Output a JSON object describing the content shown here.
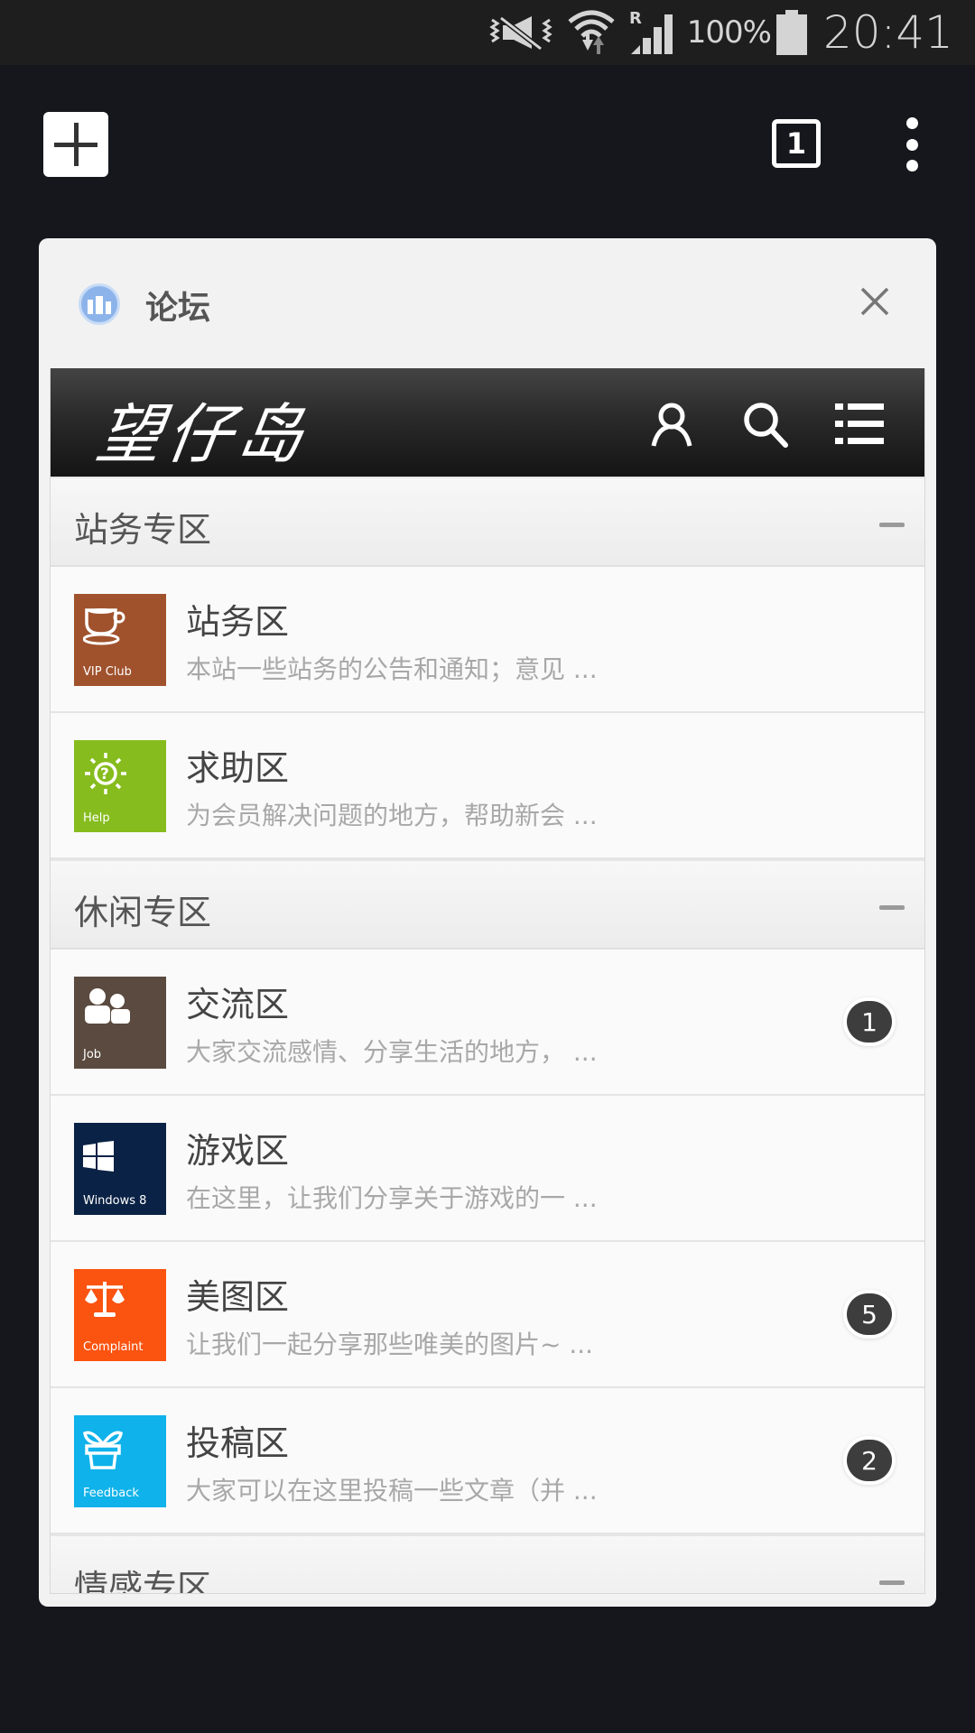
{
  "status_bar": {
    "icons": [
      "vibrate-mute-icon",
      "wifi-icon",
      "roaming-signal-icon",
      "battery-icon"
    ],
    "roaming_label": "R",
    "battery_percent": "100%",
    "time": "20:41"
  },
  "toolbar": {
    "new_tab_icon": "plus-icon",
    "tab_count": "1",
    "overflow_icon": "more-vertical-icon"
  },
  "tab_card": {
    "title": "论坛",
    "close_icon": "close-icon"
  },
  "site": {
    "logo": "望仔岛",
    "header_icons": [
      "user-icon",
      "search-icon",
      "menu-icon"
    ]
  },
  "sections": [
    {
      "title": "站务专区",
      "forums": [
        {
          "name": "站务区",
          "desc": "本站一些站务的公告和通知；意见 ...",
          "tile_label": "VIP Club",
          "tile_color": "#a0522d",
          "icon": "coffee-cup-icon",
          "badge": null
        },
        {
          "name": "求助区",
          "desc": "为会员解决问题的地方，帮助新会 ...",
          "tile_label": "Help",
          "tile_color": "#86bc1e",
          "icon": "help-sun-icon",
          "badge": null
        }
      ]
    },
    {
      "title": "休闲专区",
      "forums": [
        {
          "name": "交流区",
          "desc": "大家交流感情、分享生活的地方， ...",
          "tile_label": "Job",
          "tile_color": "#5a4a3f",
          "icon": "people-icon",
          "badge": "1"
        },
        {
          "name": "游戏区",
          "desc": "在这里，让我们分享关于游戏的一 ...",
          "tile_label": "Windows 8",
          "tile_color": "#0a2245",
          "icon": "windows-icon",
          "badge": null
        },
        {
          "name": "美图区",
          "desc": "让我们一起分享那些唯美的图片~ ...",
          "tile_label": "Complaint",
          "tile_color": "#fb5310",
          "icon": "scales-icon",
          "badge": "5"
        },
        {
          "name": "投稿区",
          "desc": "大家可以在这里投稿一些文章（并 ...",
          "tile_label": "Feedback",
          "tile_color": "#0fb2ea",
          "icon": "plant-pot-icon",
          "badge": "2"
        }
      ]
    },
    {
      "title": "情感专区",
      "forums": []
    }
  ]
}
